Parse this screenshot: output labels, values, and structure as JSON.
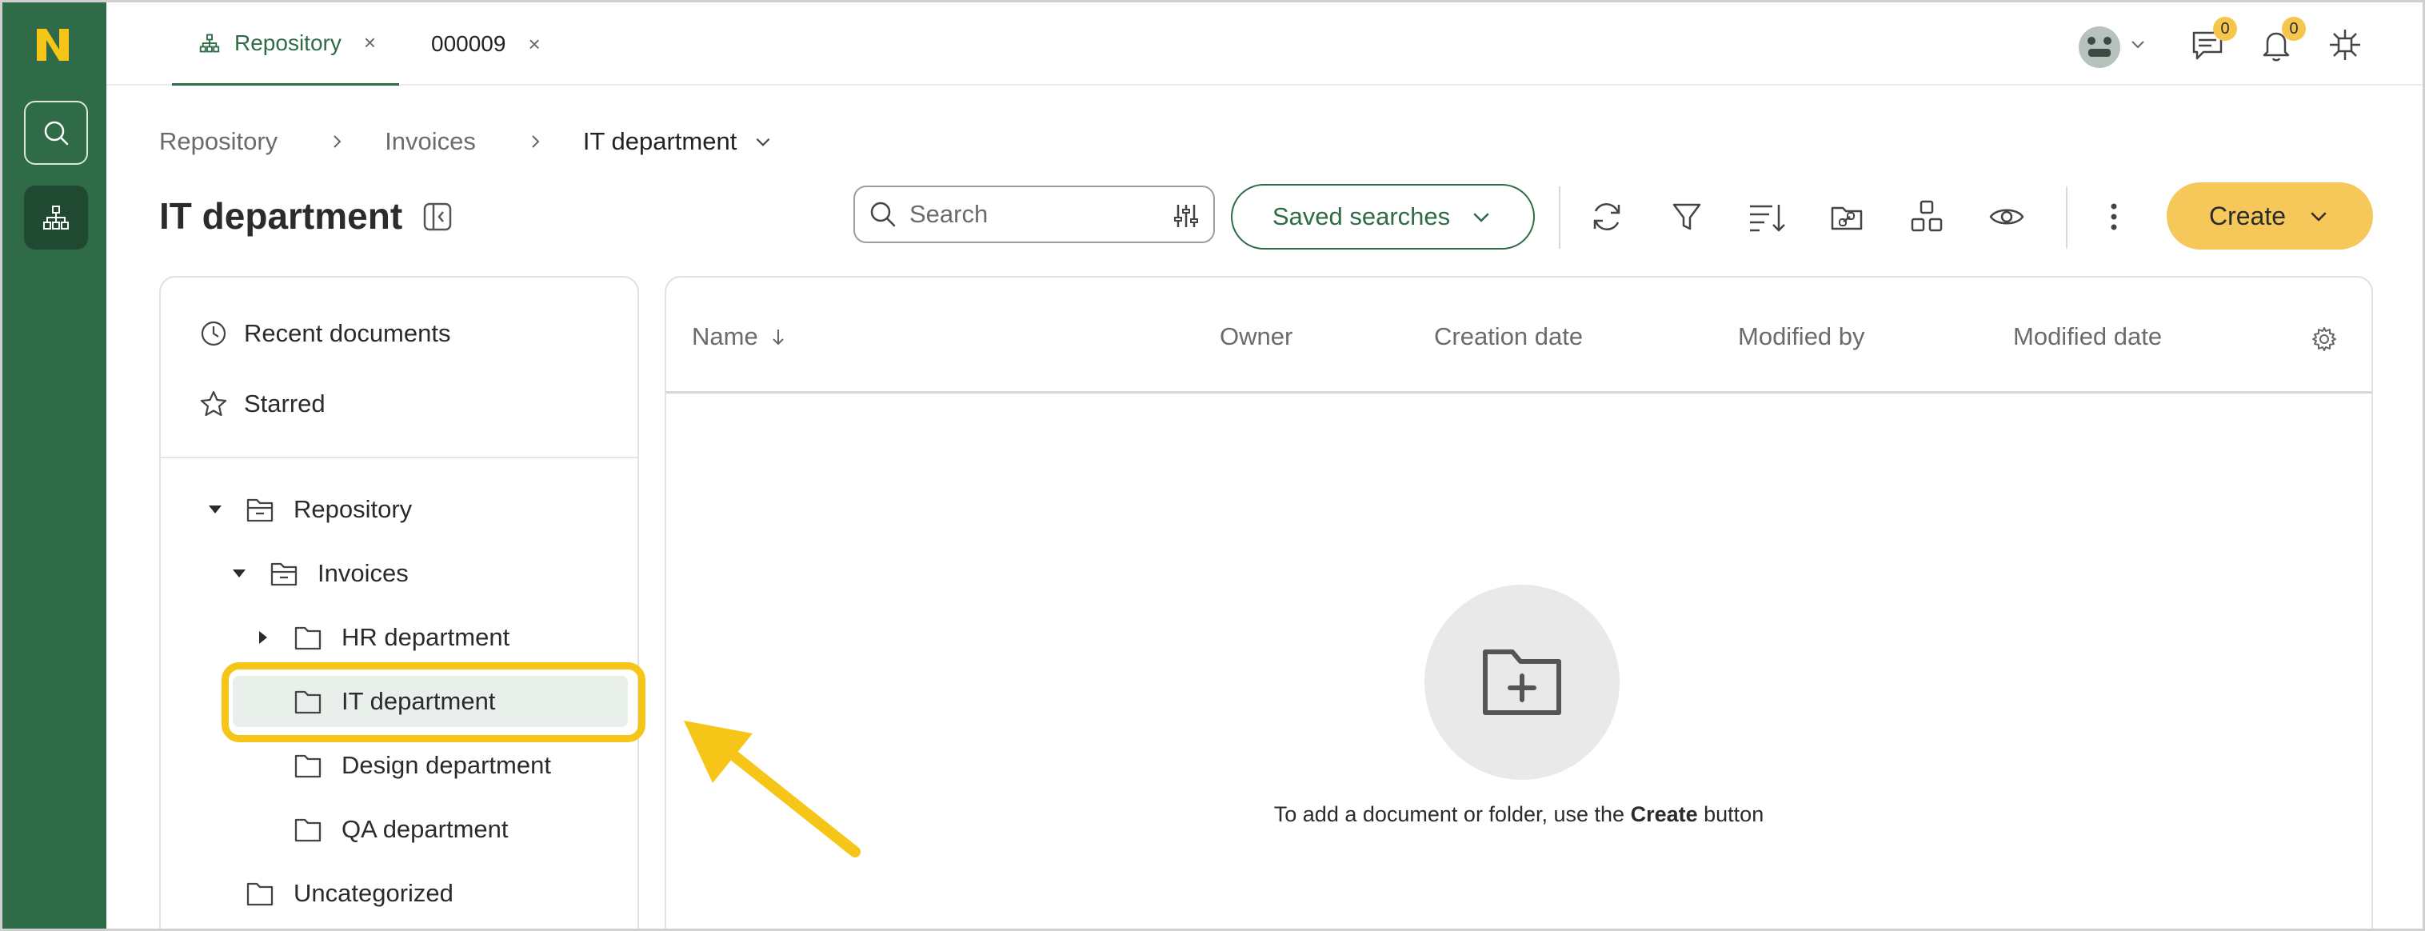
{
  "tabs": [
    {
      "label": "Repository",
      "icon": "sitemap-icon",
      "active": true
    },
    {
      "label": "000009",
      "icon": "",
      "active": false
    }
  ],
  "tab_close_glyph": "×",
  "topbar": {
    "messages_count": "0",
    "notifications_count": "0"
  },
  "breadcrumb": [
    "Repository",
    "Invoices",
    "IT department"
  ],
  "page_title": "IT department",
  "search": {
    "placeholder": "Search"
  },
  "saved_searches_label": "Saved searches",
  "create_label": "Create",
  "sidebar": {
    "quick_links": [
      {
        "label": "Recent documents",
        "icon": "clock-icon"
      },
      {
        "label": "Starred",
        "icon": "star-icon"
      }
    ],
    "tree": [
      {
        "label": "Repository",
        "level": 0,
        "expanded": true
      },
      {
        "label": "Invoices",
        "level": 1,
        "expanded": true
      },
      {
        "label": "HR department",
        "level": 2,
        "expanded": false
      },
      {
        "label": "IT department",
        "level": 2,
        "selected": true
      },
      {
        "label": "Design department",
        "level": 2
      },
      {
        "label": "QA department",
        "level": 2
      },
      {
        "label": "Uncategorized",
        "level": 0
      }
    ]
  },
  "table": {
    "columns": [
      "Name",
      "Owner",
      "Creation date",
      "Modified by",
      "Modified date"
    ],
    "empty_prefix": "To add a document or folder, use the",
    "empty_bold": "Create",
    "empty_suffix": "button"
  },
  "colors": {
    "brand_green": "#2f6b47",
    "accent_yellow": "#f6c85a",
    "highlight_yellow": "#f5c518"
  }
}
